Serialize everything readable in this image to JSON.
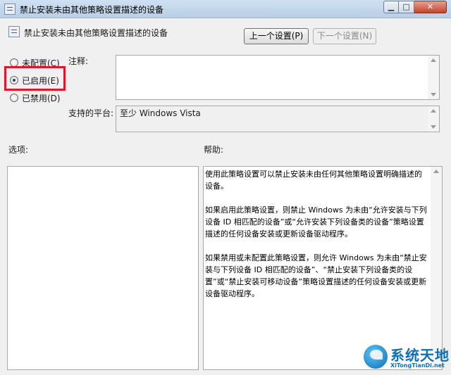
{
  "window": {
    "title": "禁止安装未由其他策略设置描述的设备",
    "minimize_glyph": "▁",
    "maximize_glyph": "□",
    "close_glyph": "✕"
  },
  "setting": {
    "title": "禁止安装未由其他策略设置描述的设备"
  },
  "nav": {
    "prev_label": "上一个设置(P)",
    "next_label": "下一个设置(N)"
  },
  "state": {
    "options": [
      {
        "label": "未配置(C)",
        "checked": false
      },
      {
        "label": "已启用(E)",
        "checked": true
      },
      {
        "label": "已禁用(D)",
        "checked": false
      }
    ]
  },
  "comment": {
    "label": "注释:",
    "value": ""
  },
  "platform": {
    "label": "支持的平台:",
    "value": "至少 Windows Vista"
  },
  "options_panel": {
    "label": "选项:"
  },
  "help": {
    "label": "帮助:",
    "paragraphs": [
      "使用此策略设置可以禁止安装未由任何其他策略设置明确描述的设备。",
      "如果启用此策略设置，则禁止 Windows 为未由“允许安装与下列设备 ID 相匹配的设备”或“允许安装下列设备类的设备”策略设置描述的任何设备安装或更新设备驱动程序。",
      "如果禁用或未配置此策略设置，则允许 Windows 为未由“禁止安装与下列设备 ID 相匹配的设备”、“禁止安装下列设备类的设置”或“禁止安装可移动设备”策略设置描述的任何设备安装或更新设备驱动程序。"
    ]
  },
  "watermark": {
    "name": "系统天地",
    "url": "XiTongTianDi.net"
  },
  "colors": {
    "highlight_border": "#e4142c",
    "watermark_blue": "#0e6fb7"
  },
  "icons": [
    "policy-window-icon",
    "policy-setting-icon",
    "scroll-up-icon",
    "scroll-down-icon",
    "watermark-logo-icon"
  ]
}
